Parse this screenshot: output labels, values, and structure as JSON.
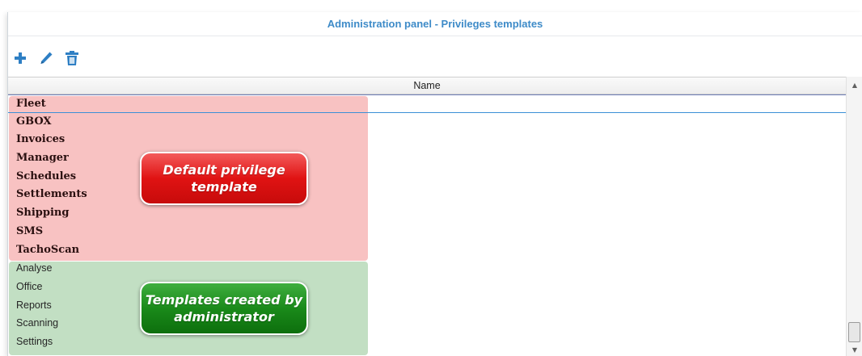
{
  "window": {
    "title": "Administration panel - Privileges templates"
  },
  "toolbar": {
    "buttons": [
      {
        "icon": "plus-icon",
        "color": "#2e7fc4"
      },
      {
        "icon": "pencil-icon",
        "color": "#2e7fc4"
      },
      {
        "icon": "trash-icon",
        "color": "#2e7fc4"
      }
    ]
  },
  "grid": {
    "column_header": "Name",
    "default_rows": [
      "Fleet",
      "GBOX",
      "Invoices",
      "Manager",
      "Schedules",
      "Settlements",
      "Shipping",
      "SMS",
      "TachoScan"
    ],
    "custom_rows": [
      "Analyse",
      "Office",
      "Reports",
      "Scanning",
      "Settings"
    ],
    "selected_row": "Fleet"
  },
  "callouts": {
    "default": "Default privilege template",
    "custom": "Templates created by administrator"
  },
  "colors": {
    "title": "#3e8bc8",
    "default_band": "#f8c2c2",
    "custom_band": "#c2dfc3",
    "default_callout": "#e01313",
    "custom_callout": "#1a8a1a"
  }
}
